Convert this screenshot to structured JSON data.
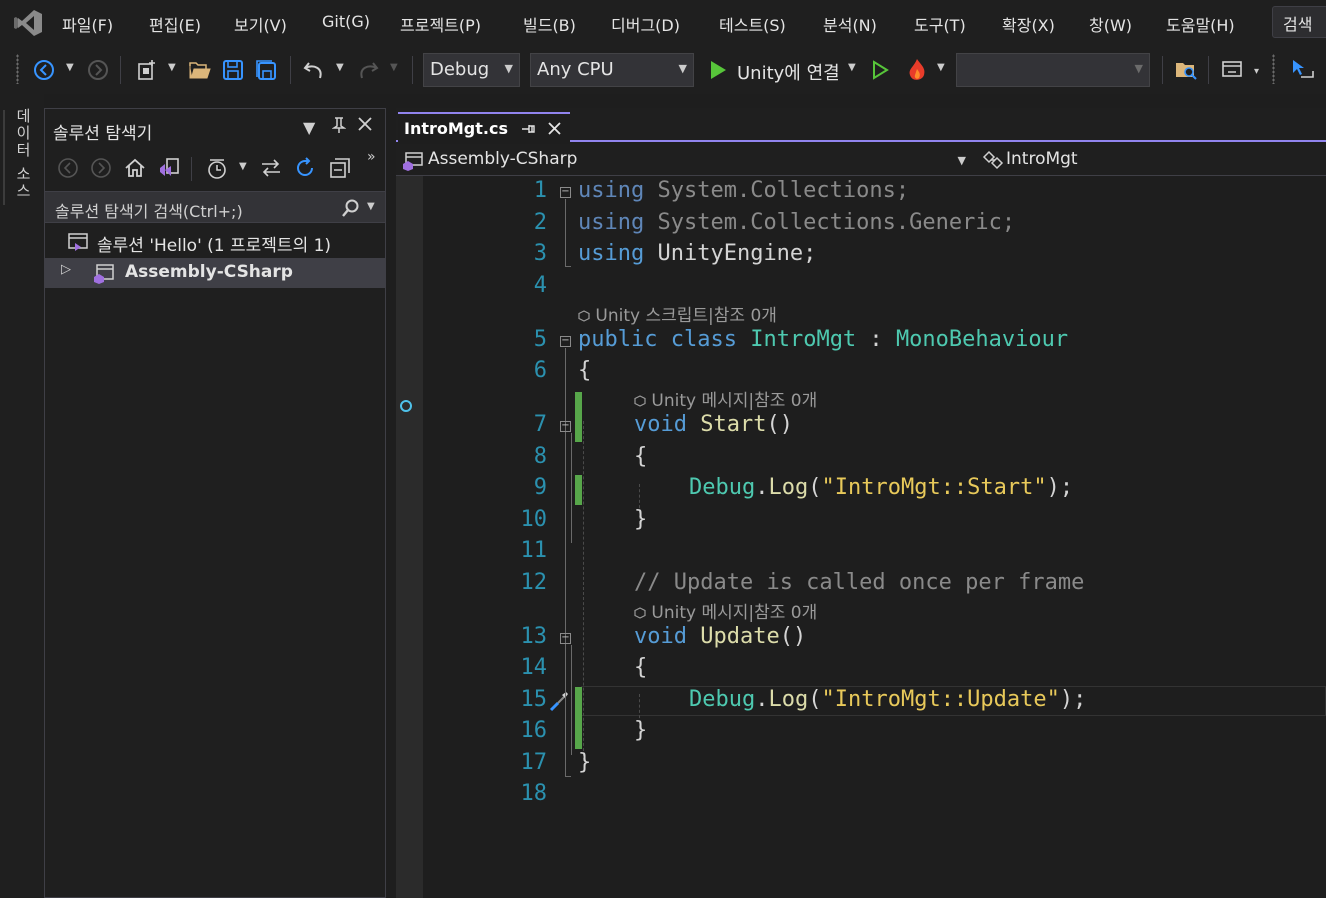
{
  "menu": {
    "items": [
      "파일(F)",
      "편집(E)",
      "보기(V)",
      "Git(G)",
      "프로젝트(P)",
      "빌드(B)",
      "디버그(D)",
      "테스트(S)",
      "분석(N)",
      "도구(T)",
      "확장(X)",
      "창(W)",
      "도움말(H)"
    ],
    "search_label": "검색"
  },
  "toolbar": {
    "configuration": "Debug",
    "platform": "Any CPU",
    "run_target": "Unity에 연결",
    "startup_combo_value": ""
  },
  "left_strip": {
    "data_source_tab": "데이터 소스"
  },
  "solution_explorer": {
    "title": "솔루션 탐색기",
    "search_placeholder": "솔루션 탐색기 검색(Ctrl+;)",
    "tree": [
      {
        "label": "솔루션 'Hello' (1 프로젝트의 1)",
        "bold": false
      },
      {
        "label": "Assembly-CSharp",
        "bold": true
      }
    ]
  },
  "editor": {
    "tab_name": "IntroMgt.cs",
    "nav_project": "Assembly-CSharp",
    "nav_class": "IntroMgt",
    "lens": {
      "class_lens": "Unity 스크립트|참조 0개",
      "start_lens": "Unity 메시지|참조 0개",
      "update_lens": "Unity 메시지|참조 0개"
    },
    "line_numbers": [
      "1",
      "2",
      "3",
      "4",
      "5",
      "6",
      "7",
      "8",
      "9",
      "10",
      "11",
      "12",
      "13",
      "14",
      "15",
      "16",
      "17",
      "18"
    ],
    "code": {
      "l1_kw": "using",
      "l1_rest": " System.Collections;",
      "l2_kw": "using",
      "l2_rest": " System.Collections.Generic;",
      "l3_kw": "using",
      "l3_rest": " UnityEngine;",
      "l5_kw1": "public",
      "l5_kw2": "class",
      "l5_name": "IntroMgt",
      "l5_colon": " : ",
      "l5_base": "MonoBehaviour",
      "l6": "{",
      "l7_kw": "void",
      "l7_name": "Start",
      "l7_parens": "()",
      "l8": "{",
      "l9_type": "Debug",
      "l9_dot": ".",
      "l9_method": "Log",
      "l9_open": "(",
      "l9_str": "\"IntroMgt::Start\"",
      "l9_close": ");",
      "l10": "}",
      "l12": "// Update is called once per frame",
      "l13_kw": "void",
      "l13_name": "Update",
      "l13_parens": "()",
      "l14": "{",
      "l15_type": "Debug",
      "l15_dot": ".",
      "l15_method": "Log",
      "l15_open": "(",
      "l15_str": "\"IntroMgt::Update\"",
      "l15_close": ");",
      "l16": "}",
      "l17": "}"
    }
  }
}
